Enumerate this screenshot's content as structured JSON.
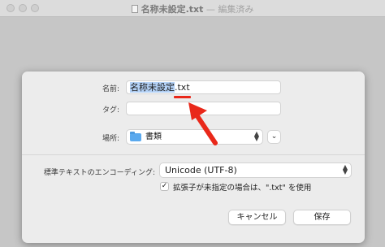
{
  "window": {
    "title_name": "名称未設定.txt",
    "title_separator": "—",
    "title_state": "編集済み"
  },
  "save_sheet": {
    "name_label": "名前:",
    "name_value": "名称未設定.txt",
    "name_selected_part": "名称未設定",
    "name_extension": ".txt",
    "tags_label": "タグ:",
    "tags_value": "",
    "location_label": "場所:",
    "location_value": "書類",
    "encoding_label": "標準テキストのエンコーディング:",
    "encoding_value": "Unicode (UTF-8)",
    "extension_checkbox_label": "拡張子が未指定の場合は、\".txt\" を使用",
    "extension_checkbox_checked": true,
    "cancel_label": "キャンセル",
    "save_label": "保存"
  },
  "annotation": {
    "color": "#e9281a"
  }
}
